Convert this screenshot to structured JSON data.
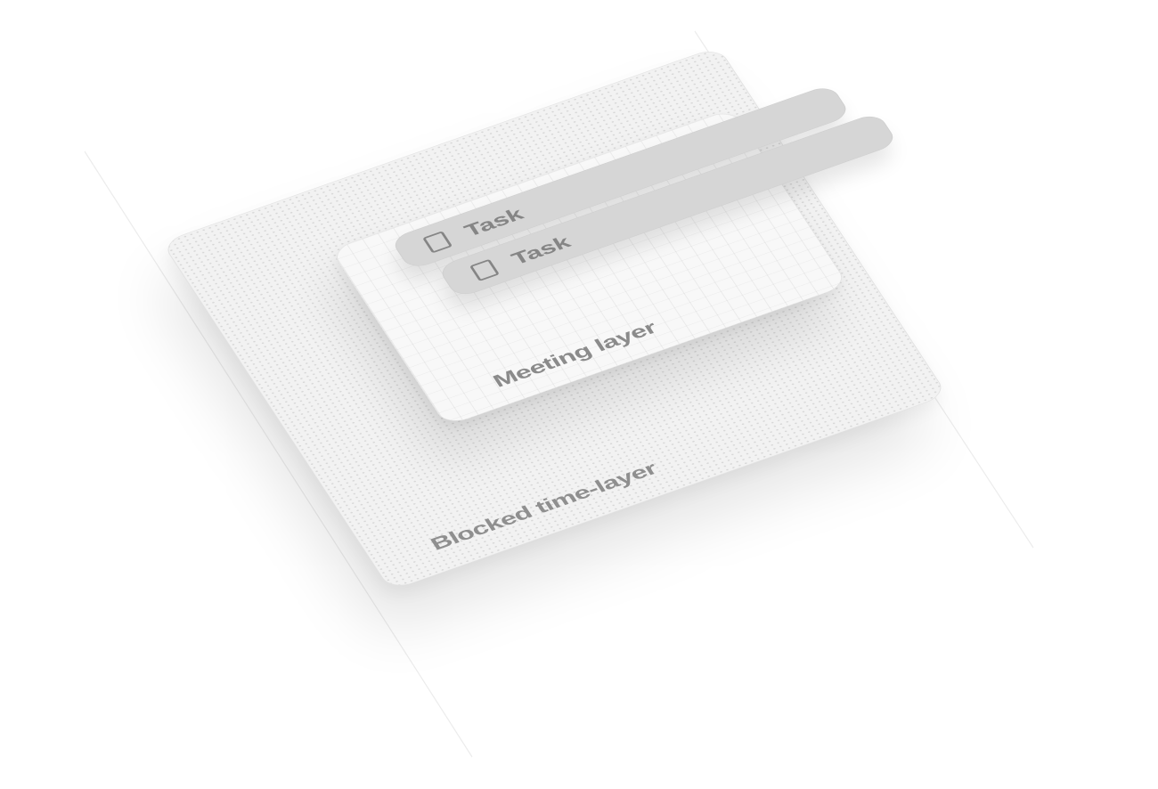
{
  "layers": {
    "blocked": {
      "label": "Blocked time-layer"
    },
    "meeting": {
      "label": "Meeting layer"
    }
  },
  "tasks": [
    {
      "label": "Task",
      "checked": false
    },
    {
      "label": "Task",
      "checked": false
    }
  ],
  "colors": {
    "background": "#ffffff",
    "layer_fill": "#f2f2f2",
    "task_fill": "#d6d6d6",
    "text": "#8a8a8a"
  },
  "icons": [
    "checkbox-icon"
  ]
}
